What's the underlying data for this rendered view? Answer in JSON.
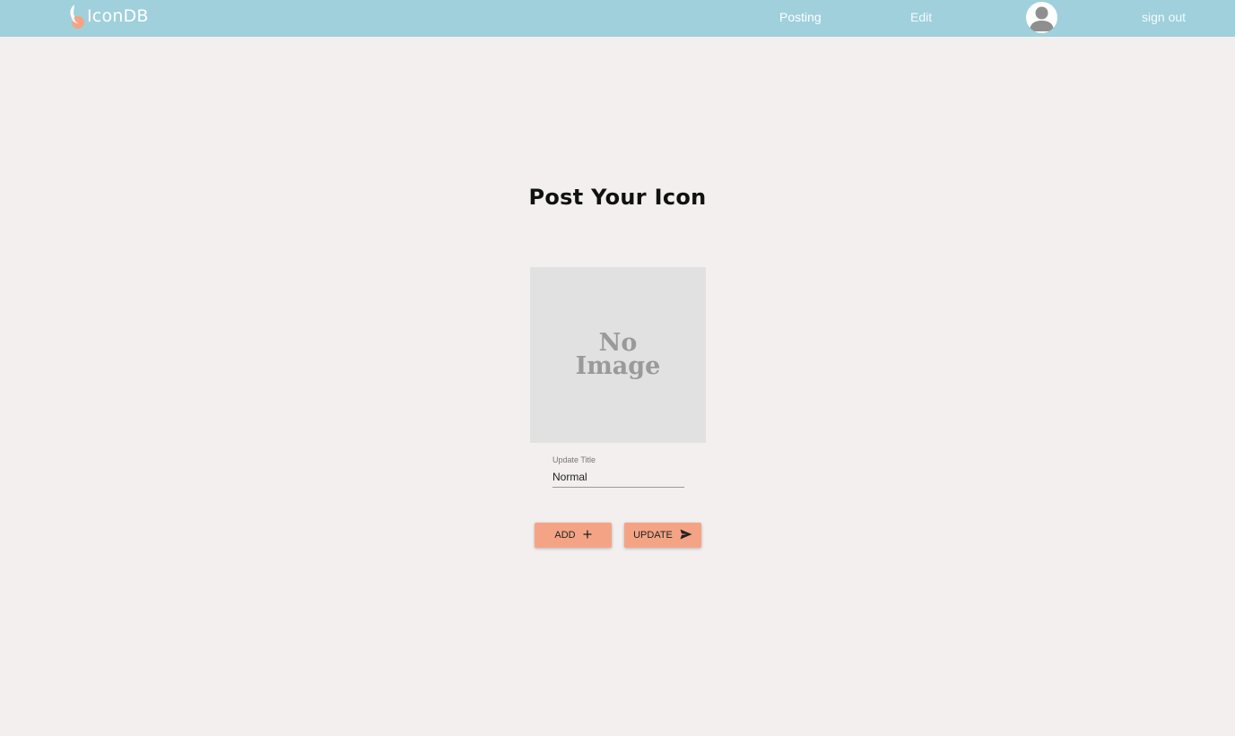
{
  "header": {
    "logo_text": "IconDB",
    "nav": {
      "posting": "Posting",
      "edit": "Edit",
      "sign_out": "sign out"
    },
    "avatar_icon": "user-avatar-icon"
  },
  "main": {
    "title": "Post Your Icon",
    "image_placeholder": {
      "line1": "No",
      "line2": "Image"
    },
    "title_field": {
      "label": "Update Title",
      "value": "Normal"
    },
    "buttons": {
      "add_label": "ADD",
      "add_icon": "plus-icon",
      "update_label": "UPDATE",
      "update_icon": "send-icon"
    }
  },
  "colors": {
    "header_bg": "#9fd0dc",
    "page_bg": "#f2efee",
    "button_bg": "#f4a485",
    "placeholder_bg": "#e1e1e1"
  }
}
